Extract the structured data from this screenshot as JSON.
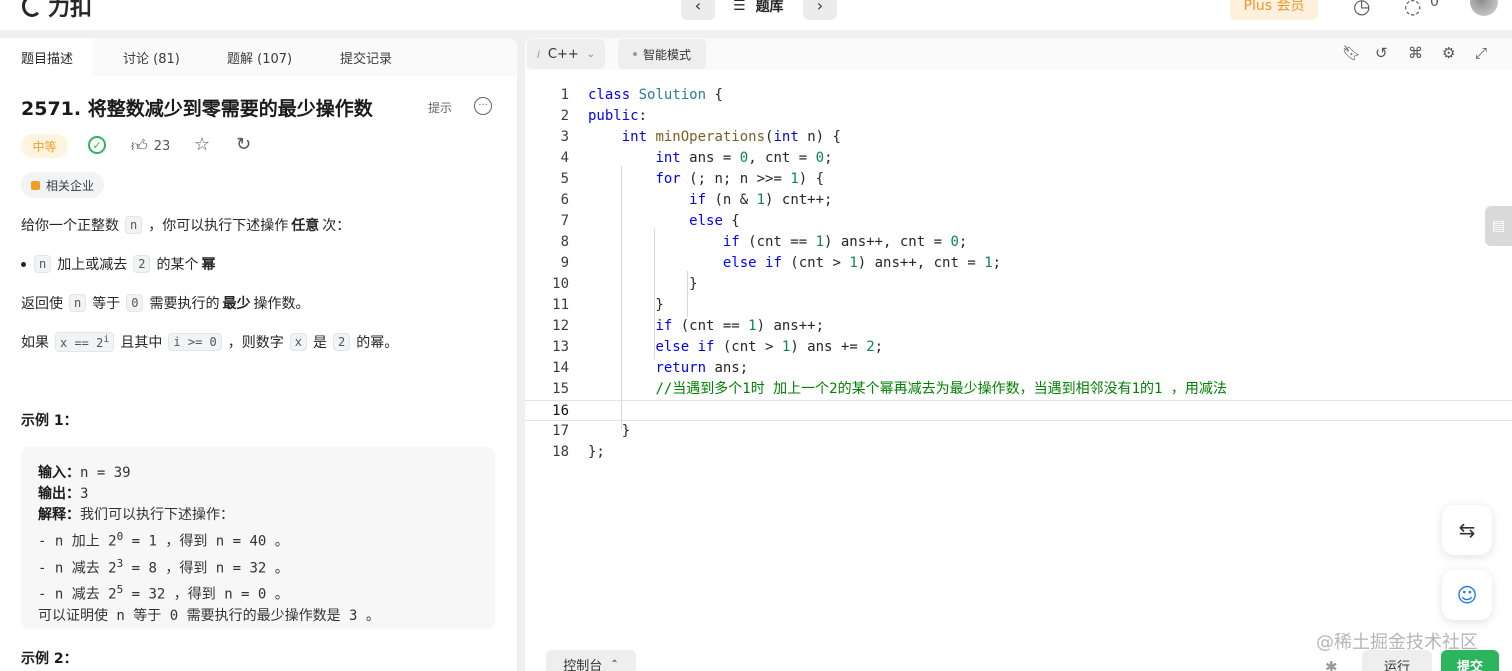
{
  "header": {
    "logo_text": "力扣",
    "nav_prev_icon": "‹",
    "nav_next_icon": "›",
    "problem_list_label": "题库",
    "plus_label": "Plus 会员",
    "fire_count": "0"
  },
  "left_tabs": [
    "题目描述",
    "讨论 (81)",
    "题解 (107)",
    "提交记录"
  ],
  "problem": {
    "title": "2571. 将整数减少到零需要的最少操作数",
    "hint_label": "提示",
    "difficulty": "中等",
    "likes": "23",
    "company_label": "相关企业"
  },
  "description": {
    "p1_pre": "给你一个正整数",
    "p1_code": "n",
    "p1_mid": "，你可以执行下述操作",
    "p1_bold": "任意",
    "p1_post": "次：",
    "bullet_code1": "n",
    "bullet_mid": "加上或减去",
    "bullet_code2": "2",
    "bullet_post_text": "的某个",
    "bullet_bold": "幂",
    "p2_pre": "返回使",
    "p2_code1": "n",
    "p2_mid": "等于",
    "p2_code2": "0",
    "p2_mid2": "需要执行的",
    "p2_bold": "最少",
    "p2_post": "操作数。",
    "p3_pre": "如果",
    "p3_code1": "x == 2",
    "p3_sup": "i",
    "p3_mid": "且其中",
    "p3_code2": "i >= 0",
    "p3_mid2": "，则数字",
    "p3_code3": "x",
    "p3_mid3": "是",
    "p3_code4": "2",
    "p3_post": "的幂。"
  },
  "example1": {
    "title": "示例 1：",
    "input_label": "输入：",
    "input_value": "n = 39",
    "output_label": "输出：",
    "output_value": "3",
    "explain_label": "解释：",
    "explain_text": "我们可以执行下述操作：",
    "step1_pre": "- n 加上 2",
    "step1_sup": "0",
    "step1_post": " = 1 ，得到 n = 40 。",
    "step2_pre": "- n 减去 2",
    "step2_sup": "3",
    "step2_post": " = 8 ，得到 n = 32 。",
    "step3_pre": "- n 减去 2",
    "step3_sup": "5",
    "step3_post": " = 32 ，得到 n = 0 。",
    "conclusion": "可以证明使 n 等于 0 需要执行的最少操作数是 3 。"
  },
  "example2": {
    "title": "示例 2："
  },
  "editor": {
    "language": "C++",
    "language_icon": "i",
    "mode_label": "智能模式",
    "line_numbers": [
      "1",
      "2",
      "3",
      "4",
      "5",
      "6",
      "7",
      "8",
      "9",
      "10",
      "11",
      "12",
      "13",
      "14",
      "15",
      "16",
      "17",
      "18"
    ],
    "comment_line": "//当遇到多个1时 加上一个2的某个幂再减去为最少操作数，当遇到相邻没有1的1 ，用减法"
  },
  "bottom": {
    "console_label": "控制台",
    "run_label": "运行",
    "submit_label": "提交"
  },
  "watermark": "@稀土掘金技术社区"
}
